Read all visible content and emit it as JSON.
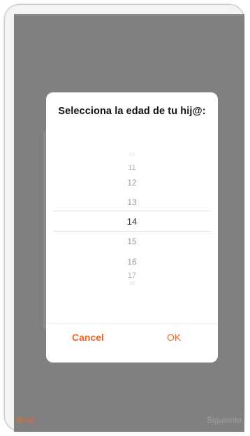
{
  "dialog": {
    "title": "Selecciona la edad de tu hij@:",
    "cancel_label": "Cancel",
    "ok_label": "OK"
  },
  "picker": {
    "items": [
      {
        "label": "10"
      },
      {
        "label": "11"
      },
      {
        "label": "12"
      },
      {
        "label": "13"
      },
      {
        "label": "14"
      },
      {
        "label": "15"
      },
      {
        "label": "16"
      },
      {
        "label": "17"
      },
      {
        "label": "18"
      }
    ],
    "selected_value": "14"
  },
  "nav": {
    "back_label": "Atrás",
    "next_label": "Siguiente"
  },
  "colors": {
    "accent": "#f26522",
    "overlay": "#808080"
  }
}
